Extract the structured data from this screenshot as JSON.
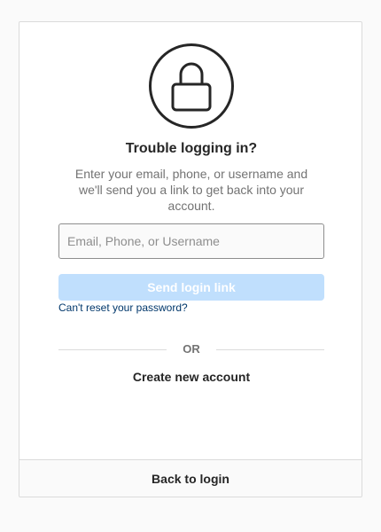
{
  "header": {
    "icon": "lock-icon",
    "title": "Trouble logging in?",
    "description": "Enter your email, phone, or username and we'll send you a link to get back into your account."
  },
  "form": {
    "input_placeholder": "Email, Phone, or Username",
    "input_value": "",
    "send_label": "Send login link",
    "reset_link": "Can't reset your password?"
  },
  "divider": {
    "label": "OR"
  },
  "create_account_label": "Create new account",
  "footer": {
    "back_label": "Back to login"
  },
  "colors": {
    "primary_disabled": "#c0dffd",
    "link": "#00376b",
    "text": "#262626",
    "muted": "#737373",
    "border": "#dbdbdb"
  }
}
